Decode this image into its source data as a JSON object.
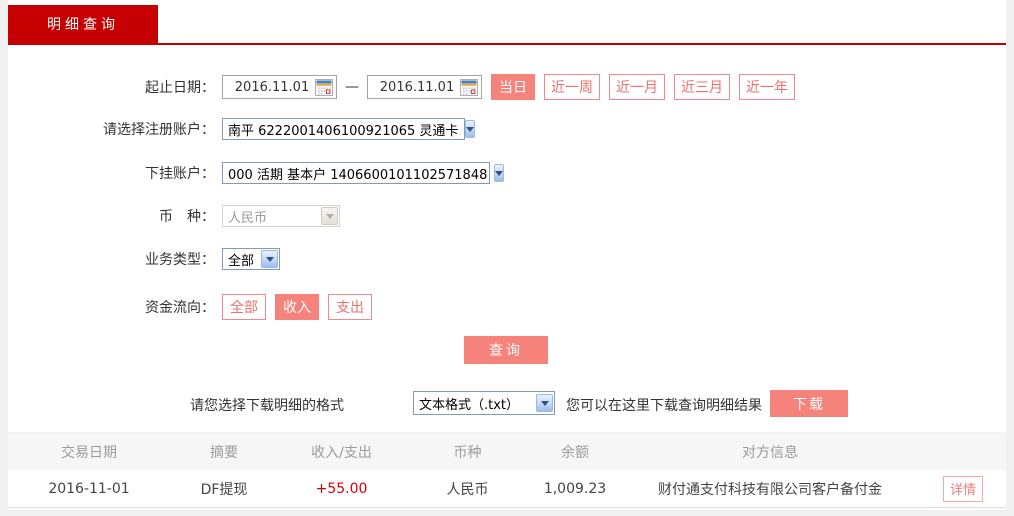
{
  "tab": {
    "label": "明细查询"
  },
  "form": {
    "date_range": {
      "label": "起止日期：",
      "start": "2016.11.01",
      "end": "2016.11.01",
      "separator": "—"
    },
    "quick_ranges": [
      {
        "label": "当日",
        "active": true
      },
      {
        "label": "近一周",
        "active": false
      },
      {
        "label": "近一月",
        "active": false
      },
      {
        "label": "近三月",
        "active": false
      },
      {
        "label": "近一年",
        "active": false
      }
    ],
    "register_account": {
      "label": "请选择注册账户：",
      "value": "南平 6222001406100921065 灵通卡"
    },
    "sub_account": {
      "label": "下挂账户：",
      "value": "000 活期 基本户 1406600101102571848"
    },
    "currency": {
      "label": "币　种：",
      "value": "人民币",
      "disabled": true
    },
    "business_type": {
      "label": "业务类型：",
      "value": "全部"
    },
    "fund_flow": {
      "label": "资金流向：",
      "options": [
        {
          "label": "全部",
          "active": false
        },
        {
          "label": "收入",
          "active": true
        },
        {
          "label": "支出",
          "active": false
        }
      ]
    },
    "query_button": "查询"
  },
  "download": {
    "format_label": "请您选择下载明细的格式",
    "format_value": "文本格式（.txt）",
    "hint": "您可以在这里下载查询明细结果",
    "button_label": "下载"
  },
  "table": {
    "headers": [
      "交易日期",
      "摘要",
      "收入/支出",
      "币种",
      "余额",
      "对方信息"
    ],
    "rows": [
      {
        "date": "2016-11-01",
        "summary": "DF提现",
        "amount": "+55.00",
        "currency": "人民币",
        "balance": "1,009.23",
        "counterparty": "财付通支付科技有限公司客户备付金",
        "detail_label": "详情"
      }
    ]
  },
  "colors": {
    "brand_red": "#c60000",
    "accent_salmon": "#f5837b",
    "outline_pink": "#f08a8a",
    "amount_red": "#d40000"
  }
}
